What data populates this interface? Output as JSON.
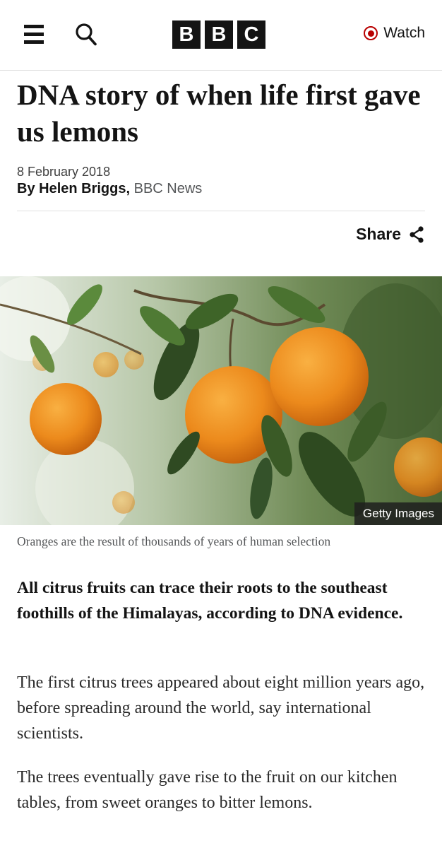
{
  "header": {
    "logo_letters": [
      "B",
      "B",
      "C"
    ],
    "watch_label": "Watch",
    "icons": {
      "menu": "menu-icon",
      "search": "search-icon",
      "watch": "live-record-icon"
    },
    "brand_color": "#b80000"
  },
  "article": {
    "headline": "DNA story of when life first gave us lemons",
    "date": "8 February 2018",
    "author": "By Helen Briggs,",
    "outlet": "BBC News",
    "share_label": "Share",
    "image": {
      "credit": "Getty Images",
      "caption": "Oranges are the result of thousands of years of human selection"
    },
    "lead": "All citrus fruits can trace their roots to the southeast foothills of the Himalayas, according to DNA evidence.",
    "paragraphs": [
      "The first citrus trees appeared about eight million years ago, before spreading around the world, say international scientists.",
      "The trees eventually gave rise to the fruit on our kitchen tables, from sweet oranges to bitter lemons."
    ]
  }
}
